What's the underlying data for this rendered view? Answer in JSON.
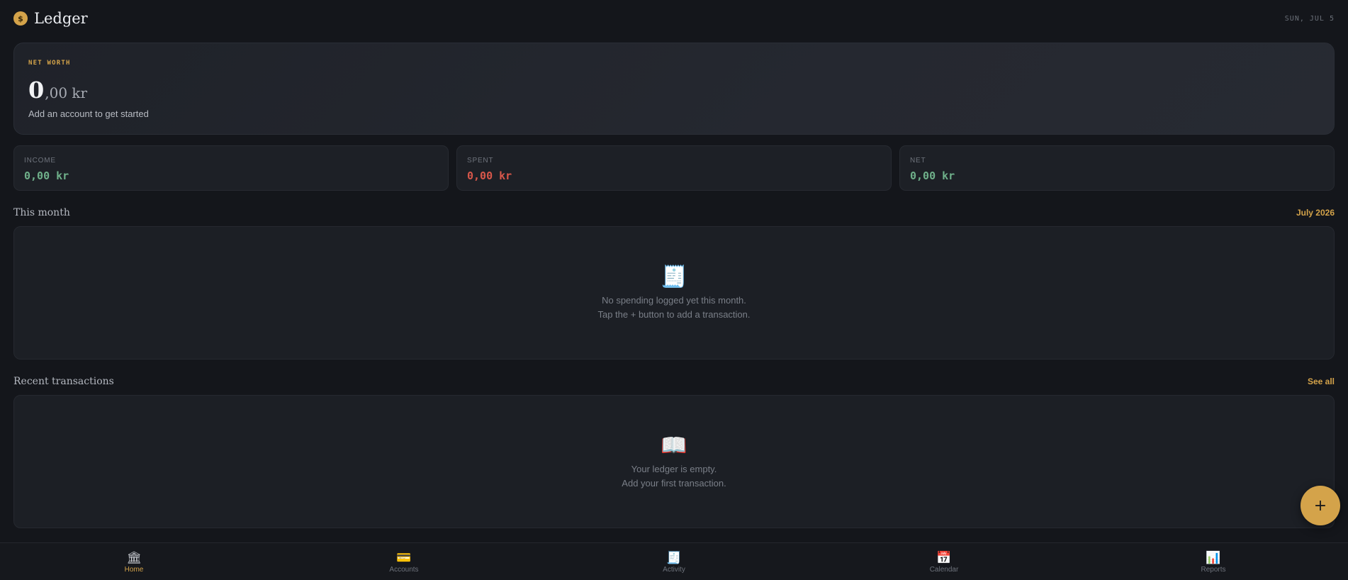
{
  "header": {
    "logo_glyph": "$",
    "title": "Ledger",
    "date": "SUN, JUL 5"
  },
  "net_worth": {
    "label": "NET WORTH",
    "amount_int": "0",
    "amount_rest": ",00 kr",
    "subtitle": "Add an account to get started"
  },
  "stats": [
    {
      "label": "INCOME",
      "value": "0,00 kr",
      "color": "#6fb08a"
    },
    {
      "label": "SPENT",
      "value": "0,00 kr",
      "color": "#d9574a"
    },
    {
      "label": "NET",
      "value": "0,00 kr",
      "color": "#6fb08a"
    }
  ],
  "this_month": {
    "title": "This month",
    "period": "July 2026",
    "empty_icon": "🧾",
    "empty_line1": "No spending logged yet this month.",
    "empty_line2": "Tap the + button to add a transaction."
  },
  "recent": {
    "title": "Recent transactions",
    "link": "See all",
    "empty_icon": "📖",
    "empty_line1": "Your ledger is empty.",
    "empty_line2": "Add your first transaction."
  },
  "fab": {
    "label": "+"
  },
  "nav": [
    {
      "icon": "🏛",
      "label": "Home",
      "active": true
    },
    {
      "icon": "💳",
      "label": "Accounts",
      "active": false
    },
    {
      "icon": "🧾",
      "label": "Activity",
      "active": false
    },
    {
      "icon": "📅",
      "label": "Calendar",
      "active": false
    },
    {
      "icon": "📊",
      "label": "Reports",
      "active": false
    }
  ],
  "colors": {
    "accent": "#d4a34a",
    "income": "#6fb08a",
    "spent": "#d9574a",
    "background": "#14161b"
  }
}
